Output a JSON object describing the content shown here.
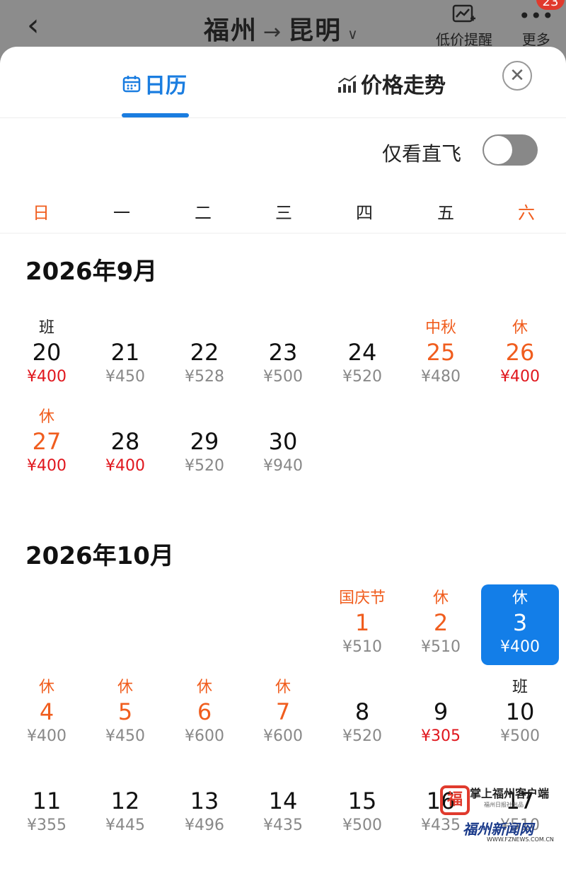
{
  "header": {
    "origin": "福州",
    "dash": "→",
    "destination": "昆明",
    "low_price_alert": "低价提醒",
    "more": "更多",
    "badge": "23"
  },
  "tabs": {
    "calendar": "日历",
    "trend": "价格走势"
  },
  "direct_only": "仅看直飞",
  "weekdays": [
    "日",
    "一",
    "二",
    "三",
    "四",
    "五",
    "六"
  ],
  "sep": {
    "title": "2026年9月",
    "days": [
      {
        "tag": "班",
        "num": "20",
        "price": "¥400"
      },
      {
        "tag": "",
        "num": "21",
        "price": "¥450"
      },
      {
        "tag": "",
        "num": "22",
        "price": "¥528"
      },
      {
        "tag": "",
        "num": "23",
        "price": "¥500"
      },
      {
        "tag": "",
        "num": "24",
        "price": "¥520"
      },
      {
        "tag": "中秋",
        "num": "25",
        "price": "¥480"
      },
      {
        "tag": "休",
        "num": "26",
        "price": "¥400"
      },
      {
        "tag": "休",
        "num": "27",
        "price": "¥400"
      },
      {
        "tag": "",
        "num": "28",
        "price": "¥400"
      },
      {
        "tag": "",
        "num": "29",
        "price": "¥520"
      },
      {
        "tag": "",
        "num": "30",
        "price": "¥940"
      }
    ]
  },
  "oct": {
    "title": "2026年10月",
    "days": [
      {
        "tag": "国庆节",
        "num": "1",
        "price": "¥510"
      },
      {
        "tag": "休",
        "num": "2",
        "price": "¥510"
      },
      {
        "tag": "休",
        "num": "3",
        "price": "¥400"
      },
      {
        "tag": "休",
        "num": "4",
        "price": "¥400"
      },
      {
        "tag": "休",
        "num": "5",
        "price": "¥450"
      },
      {
        "tag": "休",
        "num": "6",
        "price": "¥600"
      },
      {
        "tag": "休",
        "num": "7",
        "price": "¥600"
      },
      {
        "tag": "",
        "num": "8",
        "price": "¥520"
      },
      {
        "tag": "",
        "num": "9",
        "price": "¥305"
      },
      {
        "tag": "班",
        "num": "10",
        "price": "¥500"
      },
      {
        "tag": "",
        "num": "11",
        "price": "¥355"
      },
      {
        "tag": "",
        "num": "12",
        "price": "¥445"
      },
      {
        "tag": "",
        "num": "13",
        "price": "¥496"
      },
      {
        "tag": "",
        "num": "14",
        "price": "¥435"
      },
      {
        "tag": "",
        "num": "15",
        "price": "¥500"
      },
      {
        "tag": "",
        "num": "16",
        "price": "¥435"
      },
      {
        "tag": "",
        "num": "17",
        "price": "¥510"
      }
    ]
  },
  "watermark": {
    "app": "掌上福州客户端",
    "org": "福州日报社出品",
    "site": "福州新闻网",
    "url": "WWW.FZNEWS.COM.CN"
  },
  "colors": {
    "accent": "#1a7de0",
    "holiday": "#f05d1e",
    "low_price": "#e0161d"
  }
}
